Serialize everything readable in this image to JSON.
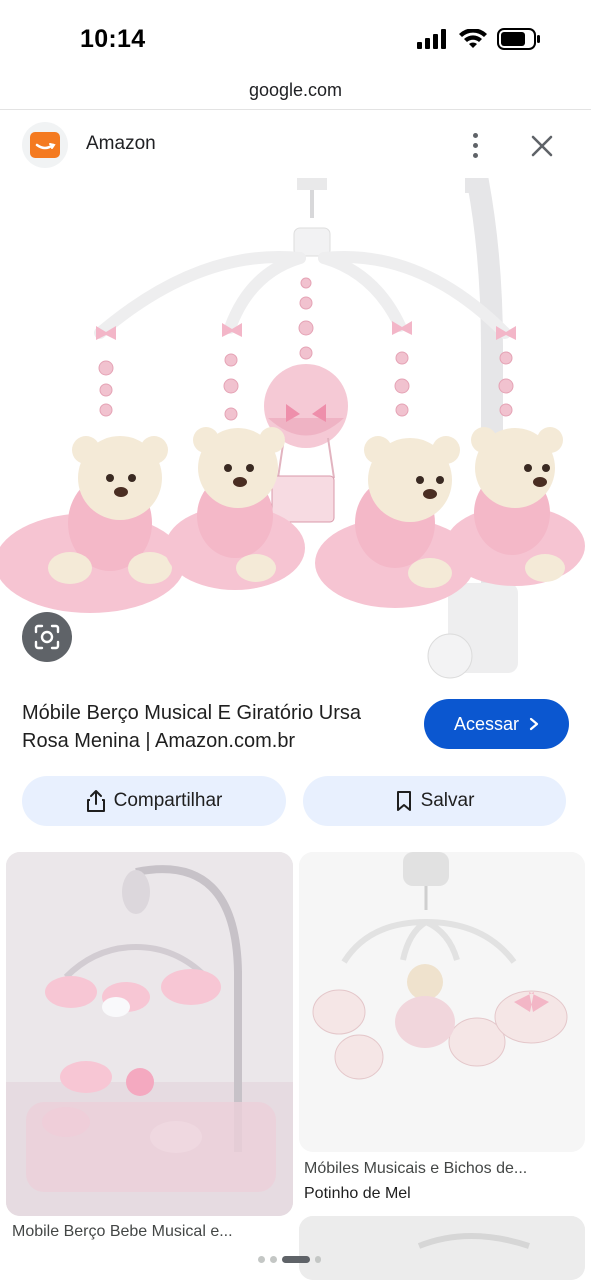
{
  "status_bar": {
    "time": "10:14"
  },
  "url_bar": {
    "domain": "google.com"
  },
  "source": {
    "name": "Amazon",
    "icon": "amazon-smile-icon"
  },
  "result": {
    "title": "Móbile Berço Musical E Giratório Ursa Rosa Menina | Amazon.com.br",
    "visit_label": "Acessar"
  },
  "actions": {
    "share_label": "Compartilhar",
    "save_label": "Salvar"
  },
  "related": [
    {
      "caption": "Mobile Berço Bebe Musical e...",
      "source": ""
    },
    {
      "caption": "Móbiles Musicais e Bichos de...",
      "source": "Potinho de Mel"
    }
  ],
  "colors": {
    "accent": "#0b57d0",
    "action_bg": "#e8f0fe",
    "amazon_orange": "#f47a20"
  }
}
